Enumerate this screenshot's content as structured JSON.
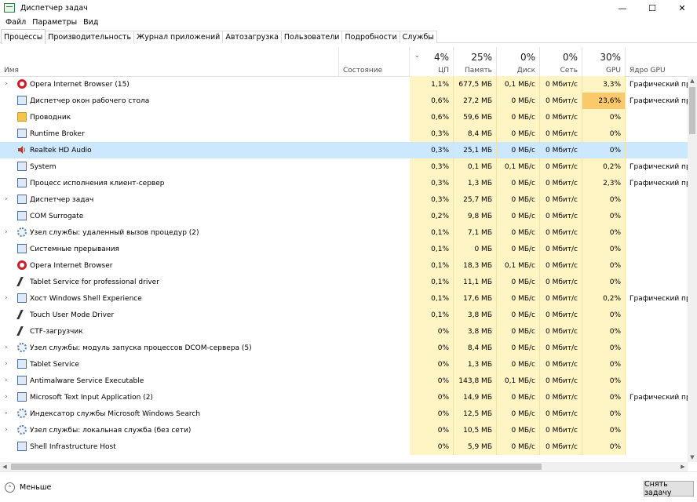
{
  "window": {
    "title": "Диспетчер задач",
    "minimize": "—",
    "maximize": "☐",
    "close": "✕"
  },
  "menu": [
    "Файл",
    "Параметры",
    "Вид"
  ],
  "tabs": [
    "Процессы",
    "Производительность",
    "Журнал приложений",
    "Автозагрузка",
    "Пользователи",
    "Подробности",
    "Службы"
  ],
  "columns": {
    "name": "Имя",
    "status": "Состояние",
    "cpu": {
      "label": "ЦП",
      "total": "4%"
    },
    "memory": {
      "label": "Память",
      "total": "25%"
    },
    "disk": {
      "label": "Диск",
      "total": "0%"
    },
    "network": {
      "label": "Сеть",
      "total": "0%"
    },
    "gpu": {
      "label": "GPU",
      "total": "30%"
    },
    "gpu_engine": "Ядро GPU",
    "sort_indicator": "⌄"
  },
  "processes": [
    {
      "name": "Opera Internet Browser (15)",
      "icon": "opera-icon",
      "expandable": true,
      "cpu": "1,1%",
      "mem": "677,5 МБ",
      "disk": "0,1 МБ/с",
      "net": "0 Мбит/с",
      "gpu": "3,3%",
      "engine": "Графический про"
    },
    {
      "name": "Диспетчер окон рабочего стола",
      "icon": "window-icon",
      "expandable": false,
      "cpu": "0,6%",
      "mem": "27,2 МБ",
      "disk": "0 МБ/с",
      "net": "0 Мбит/с",
      "gpu": "23,6%",
      "engine": "Графический про"
    },
    {
      "name": "Проводник",
      "icon": "folder-icon",
      "expandable": false,
      "cpu": "0,6%",
      "mem": "59,6 МБ",
      "disk": "0 МБ/с",
      "net": "0 Мбит/с",
      "gpu": "0%",
      "engine": ""
    },
    {
      "name": "Runtime Broker",
      "icon": "window-icon",
      "expandable": false,
      "cpu": "0,3%",
      "mem": "8,4 МБ",
      "disk": "0 МБ/с",
      "net": "0 Мбит/с",
      "gpu": "0%",
      "engine": ""
    },
    {
      "name": "Realtek HD Audio",
      "icon": "speaker-icon",
      "expandable": false,
      "selected": true,
      "cpu": "0,3%",
      "mem": "25,1 МБ",
      "disk": "0 МБ/с",
      "net": "0 Мбит/с",
      "gpu": "0%",
      "engine": ""
    },
    {
      "name": "System",
      "icon": "window-icon",
      "expandable": false,
      "cpu": "0,3%",
      "mem": "0,1 МБ",
      "disk": "0,1 МБ/с",
      "net": "0 Мбит/с",
      "gpu": "0,2%",
      "engine": "Графический про"
    },
    {
      "name": "Процесс исполнения клиент-сервер",
      "icon": "window-icon",
      "expandable": false,
      "cpu": "0,3%",
      "mem": "1,3 МБ",
      "disk": "0 МБ/с",
      "net": "0 Мбит/с",
      "gpu": "2,3%",
      "engine": "Графический про"
    },
    {
      "name": "Диспетчер задач",
      "icon": "window-icon",
      "expandable": true,
      "cpu": "0,3%",
      "mem": "25,7 МБ",
      "disk": "0 МБ/с",
      "net": "0 Мбит/с",
      "gpu": "0%",
      "engine": ""
    },
    {
      "name": "COM Surrogate",
      "icon": "window-icon",
      "expandable": false,
      "cpu": "0,2%",
      "mem": "9,8 МБ",
      "disk": "0 МБ/с",
      "net": "0 Мбит/с",
      "gpu": "0%",
      "engine": ""
    },
    {
      "name": "Узел службы: удаленный вызов процедур (2)",
      "icon": "gear-icon",
      "expandable": true,
      "cpu": "0,1%",
      "mem": "7,1 МБ",
      "disk": "0 МБ/с",
      "net": "0 Мбит/с",
      "gpu": "0%",
      "engine": ""
    },
    {
      "name": "Системные прерывания",
      "icon": "window-icon",
      "expandable": false,
      "cpu": "0,1%",
      "mem": "0 МБ",
      "disk": "0 МБ/с",
      "net": "0 Мбит/с",
      "gpu": "0%",
      "engine": ""
    },
    {
      "name": "Opera Internet Browser",
      "icon": "opera-icon",
      "expandable": false,
      "cpu": "0,1%",
      "mem": "18,3 МБ",
      "disk": "0,1 МБ/с",
      "net": "0 Мбит/с",
      "gpu": "0%",
      "engine": ""
    },
    {
      "name": "Tablet Service for professional driver",
      "icon": "pen-icon",
      "expandable": false,
      "cpu": "0,1%",
      "mem": "11,1 МБ",
      "disk": "0 МБ/с",
      "net": "0 Мбит/с",
      "gpu": "0%",
      "engine": ""
    },
    {
      "name": "Хост Windows Shell Experience",
      "icon": "window-icon",
      "expandable": true,
      "cpu": "0,1%",
      "mem": "17,6 МБ",
      "disk": "0 МБ/с",
      "net": "0 Мбит/с",
      "gpu": "0,2%",
      "engine": "Графический про"
    },
    {
      "name": "Touch User Mode Driver",
      "icon": "pen-icon",
      "expandable": false,
      "cpu": "0,1%",
      "mem": "3,8 МБ",
      "disk": "0 МБ/с",
      "net": "0 Мбит/с",
      "gpu": "0%",
      "engine": ""
    },
    {
      "name": "CTF-загрузчик",
      "icon": "pen-icon",
      "expandable": false,
      "cpu": "0%",
      "mem": "3,8 МБ",
      "disk": "0 МБ/с",
      "net": "0 Мбит/с",
      "gpu": "0%",
      "engine": ""
    },
    {
      "name": "Узел службы: модуль запуска процессов DCOM-сервера (5)",
      "icon": "gear-icon",
      "expandable": true,
      "cpu": "0%",
      "mem": "8,4 МБ",
      "disk": "0 МБ/с",
      "net": "0 Мбит/с",
      "gpu": "0%",
      "engine": ""
    },
    {
      "name": "Tablet Service",
      "icon": "window-icon",
      "expandable": true,
      "cpu": "0%",
      "mem": "1,3 МБ",
      "disk": "0 МБ/с",
      "net": "0 Мбит/с",
      "gpu": "0%",
      "engine": ""
    },
    {
      "name": "Antimalware Service Executable",
      "icon": "window-icon",
      "expandable": true,
      "cpu": "0%",
      "mem": "143,8 МБ",
      "disk": "0,1 МБ/с",
      "net": "0 Мбит/с",
      "gpu": "0%",
      "engine": ""
    },
    {
      "name": "Microsoft Text Input Application (2)",
      "icon": "window-icon",
      "expandable": true,
      "cpu": "0%",
      "mem": "14,9 МБ",
      "disk": "0 МБ/с",
      "net": "0 Мбит/с",
      "gpu": "0%",
      "engine": "Графический про"
    },
    {
      "name": "Индексатор службы Microsoft Windows Search",
      "icon": "gear-icon",
      "expandable": true,
      "cpu": "0%",
      "mem": "12,5 МБ",
      "disk": "0 МБ/с",
      "net": "0 Мбит/с",
      "gpu": "0%",
      "engine": ""
    },
    {
      "name": "Узел службы: локальная служба (без сети)",
      "icon": "gear-icon",
      "expandable": true,
      "cpu": "0%",
      "mem": "10,5 МБ",
      "disk": "0 МБ/с",
      "net": "0 Мбит/с",
      "gpu": "0%",
      "engine": ""
    },
    {
      "name": "Shell Infrastructure Host",
      "icon": "window-icon",
      "expandable": false,
      "cpu": "0%",
      "mem": "5,9 МБ",
      "disk": "0 МБ/с",
      "net": "0 Мбит/с",
      "gpu": "0%",
      "engine": ""
    }
  ],
  "colors": {
    "cpu_heat": "#fff4c4",
    "gpu_hot": "#f9c96b",
    "selection": "#cce8ff"
  },
  "footer": {
    "fewer_details": "Меньше",
    "end_task": "Снять задачу"
  }
}
